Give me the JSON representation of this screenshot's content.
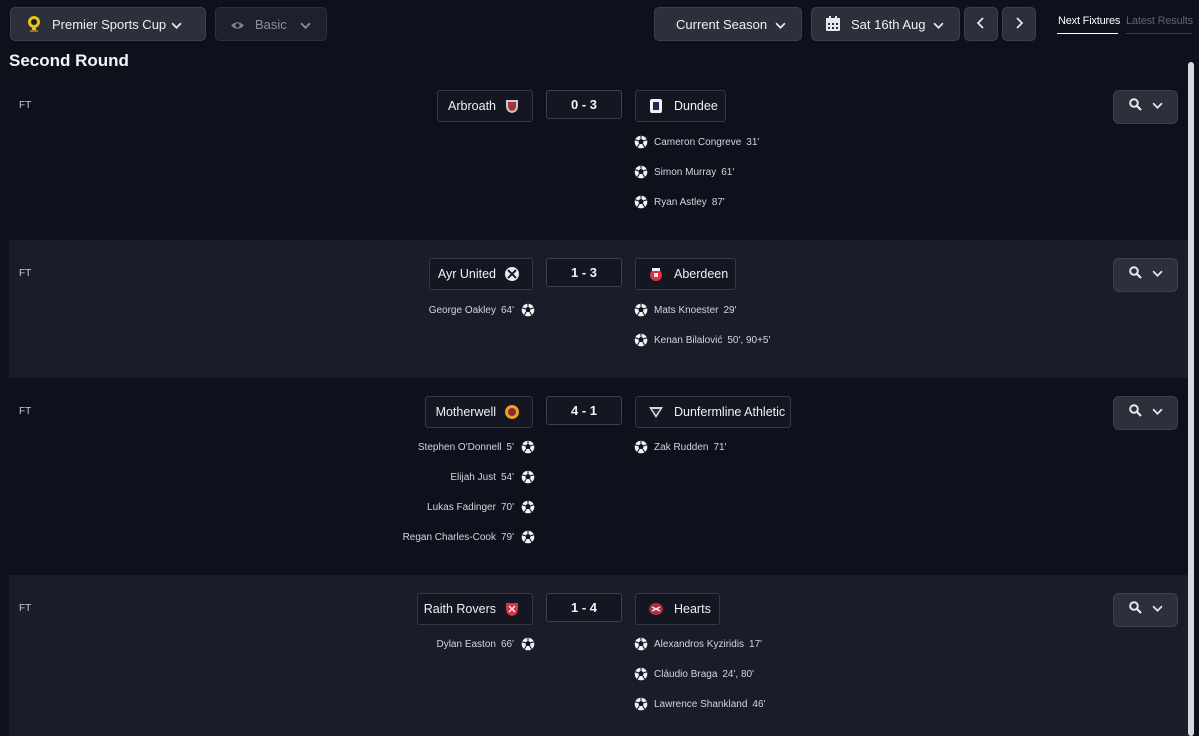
{
  "toolbar": {
    "competition": "Premier Sports Cup",
    "view_mode": "Basic",
    "season": "Current Season",
    "date": "Sat 16th Aug",
    "tabs": [
      {
        "label": "Next Fixtures",
        "active": true
      },
      {
        "label": "Latest Results",
        "active": false
      }
    ]
  },
  "section": {
    "title": "Second Round"
  },
  "matches": [
    {
      "status": "FT",
      "home": "Arbroath",
      "away": "Dundee",
      "score": "0 - 3",
      "home_goals": [],
      "away_goals": [
        {
          "player": "Cameron Congreve",
          "minute": "31'"
        },
        {
          "player": "Simon Murray",
          "minute": "61'"
        },
        {
          "player": "Ryan Astley",
          "minute": "87'"
        }
      ]
    },
    {
      "status": "FT",
      "home": "Ayr United",
      "away": "Aberdeen",
      "score": "1 - 3",
      "home_goals": [
        {
          "player": "George Oakley",
          "minute": "64'"
        }
      ],
      "away_goals": [
        {
          "player": "Mats Knoester",
          "minute": "29'"
        },
        {
          "player": "Kenan Bilalović",
          "minute": "50', 90+5'"
        }
      ]
    },
    {
      "status": "FT",
      "home": "Motherwell",
      "away": "Dunfermline Athletic",
      "score": "4 - 1",
      "home_goals": [
        {
          "player": "Stephen O'Donnell",
          "minute": "5'"
        },
        {
          "player": "Elijah Just",
          "minute": "54'"
        },
        {
          "player": "Lukas Fadinger",
          "minute": "70'"
        },
        {
          "player": "Regan Charles-Cook",
          "minute": "79'"
        }
      ],
      "away_goals": [
        {
          "player": "Zak Rudden",
          "minute": "71'"
        }
      ]
    },
    {
      "status": "FT",
      "home": "Raith Rovers",
      "away": "Hearts",
      "score": "1 - 4",
      "home_goals": [
        {
          "player": "Dylan Easton",
          "minute": "66'"
        }
      ],
      "away_goals": [
        {
          "player": "Alexandros Kyziridis",
          "minute": "17'"
        },
        {
          "player": "Cláudio Braga",
          "minute": "24', 80'"
        },
        {
          "player": "Lawrence Shankland",
          "minute": "46'"
        }
      ]
    }
  ],
  "colors": {
    "background": "#0e111c",
    "row_alt": "#1a1d29",
    "button": "#2c303b",
    "tab_active": "#ffffff",
    "tab_inactive": "#5d6270"
  },
  "icons": {
    "competition": "trophy-icon",
    "view_mode": "eye-icon",
    "date": "calendar-icon",
    "goal": "football-icon",
    "action": "search-icon"
  }
}
